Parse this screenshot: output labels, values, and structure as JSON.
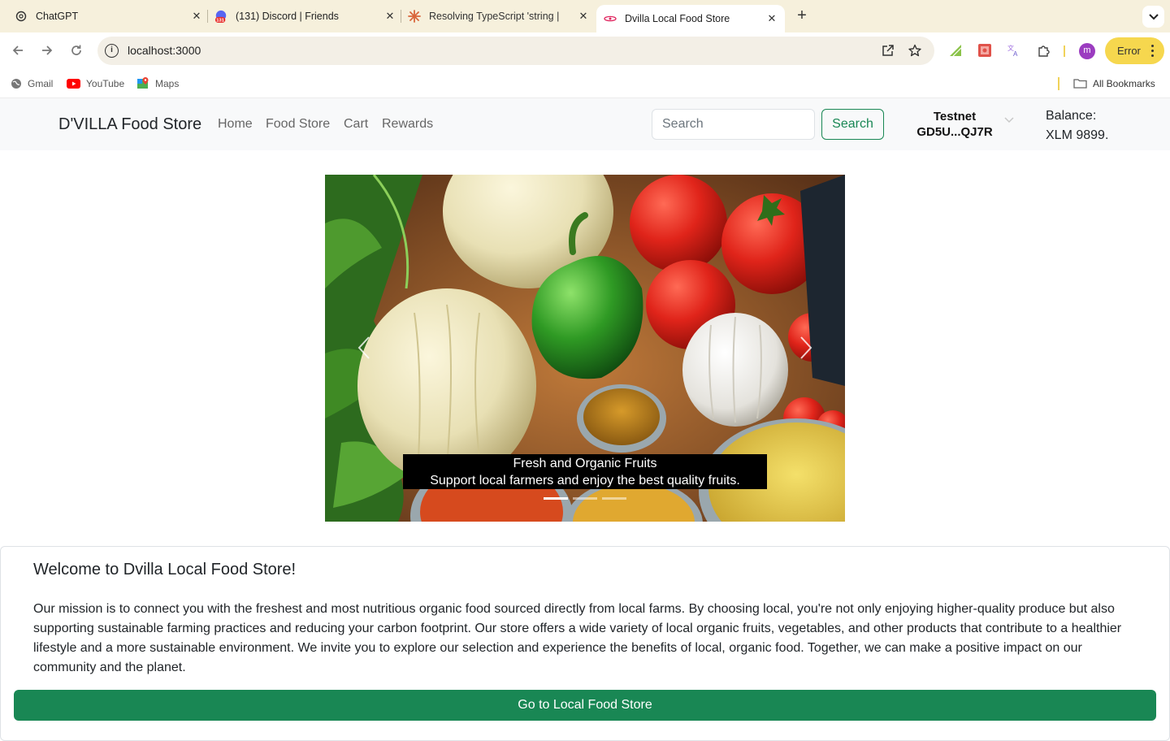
{
  "browser": {
    "tabs": [
      {
        "title": "ChatGPT",
        "icon": "chatgpt-icon"
      },
      {
        "title": "(131) Discord | Friends",
        "icon": "discord-icon",
        "badge": "131"
      },
      {
        "title": "Resolving TypeScript 'string | ",
        "icon": "claude-icon"
      },
      {
        "title": "Dvilla Local Food Store",
        "icon": "react-icon"
      }
    ],
    "url": "localhost:3000",
    "profile_initial": "m",
    "error_label": "Error",
    "bookmarks": [
      {
        "label": "Gmail",
        "icon": "globe-icon"
      },
      {
        "label": "YouTube",
        "icon": "youtube-icon"
      },
      {
        "label": "Maps",
        "icon": "maps-icon"
      }
    ],
    "all_bookmarks_label": "All Bookmarks"
  },
  "navbar": {
    "brand": "D'VILLA Food Store",
    "links": [
      "Home",
      "Food Store",
      "Cart",
      "Rewards"
    ],
    "search_placeholder": "Search",
    "search_button": "Search",
    "wallet_network": "Testnet",
    "wallet_address": "GD5U...QJ7R",
    "balance_label": "Balance:",
    "balance_value": "XLM 9899."
  },
  "carousel": {
    "caption_title": "Fresh and Organic Fruits",
    "caption_text": "Support local farmers and enjoy the best quality fruits.",
    "slide_count": 3,
    "active_slide": 0
  },
  "welcome": {
    "title": "Welcome to Dvilla Local Food Store!",
    "body": "Our mission is to connect you with the freshest and most nutritious organic food sourced directly from local farms. By choosing local, you're not only enjoying higher-quality produce but also supporting sustainable farming practices and reducing your carbon footprint. Our store offers a wide variety of local organic fruits, vegetables, and other products that contribute to a healthier lifestyle and a more sustainable environment. We invite you to explore our selection and experience the benefits of local, organic food. Together, we can make a positive impact on our community and the planet.",
    "cta": "Go to Local Food Store"
  },
  "colors": {
    "brand_green": "#198754",
    "tabbar_bg": "#f6f0dc",
    "navbar_bg": "#f8f9fa",
    "error_pill": "#f6d74e"
  }
}
